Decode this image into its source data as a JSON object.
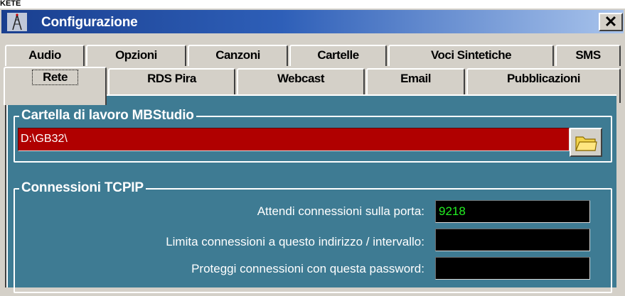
{
  "top_fragment": "KETE",
  "window": {
    "title": "Configurazione",
    "close_label": "✕",
    "app_icon": "radio-tower-icon"
  },
  "tabs": {
    "row1": [
      "Audio",
      "Opzioni",
      "Canzoni",
      "Cartelle",
      "Voci Sintetiche",
      "SMS"
    ],
    "row2": [
      "Rete",
      "RDS Pira",
      "Webcast",
      "Email",
      "Pubblicazioni"
    ],
    "active": "Rete"
  },
  "working_folder": {
    "title": "Cartella di lavoro MBStudio",
    "path": "D:\\GB32\\",
    "browse_icon": "folder-icon"
  },
  "tcpip": {
    "title": "Connessioni TCPIP",
    "port_label": "Attendi connessioni sulla porta:",
    "port_value": "9218",
    "address_label": "Limita connessioni a questo indirizzo / intervallo:",
    "address_value": "",
    "password_label": "Proteggi connessioni con questa password:",
    "password_value": ""
  },
  "colors": {
    "panel_bg": "#3e7b93",
    "path_field_bg": "#b00000",
    "port_text": "#22ee22",
    "titlebar_start": "#1a3f8f",
    "titlebar_end": "#a9c4ec"
  }
}
